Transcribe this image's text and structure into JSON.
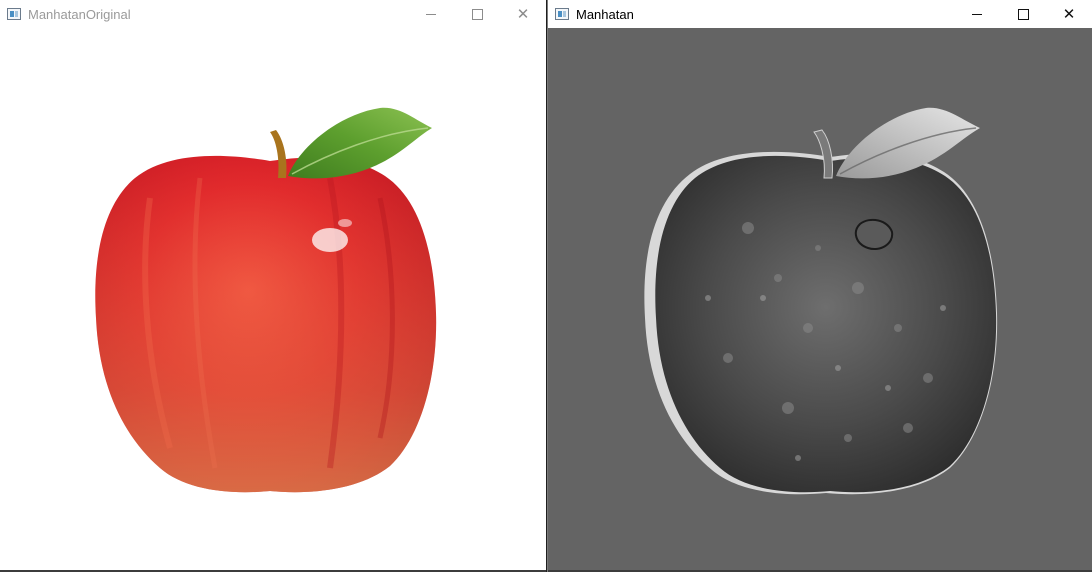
{
  "windows": [
    {
      "title": "ManhatanOriginal",
      "state": "inactive",
      "content": "color apple photo on white background"
    },
    {
      "title": "Manhatan",
      "state": "active",
      "content": "grayscale processed apple on gray background"
    }
  ],
  "colors": {
    "left_background": "#ffffff",
    "right_background": "#646464",
    "apple_red": "#d8232a",
    "leaf_green": "#5a9a2c"
  },
  "icons": {
    "minimize": "minimize-icon",
    "maximize": "maximize-icon",
    "close": "close-icon",
    "app": "app-window-icon"
  }
}
